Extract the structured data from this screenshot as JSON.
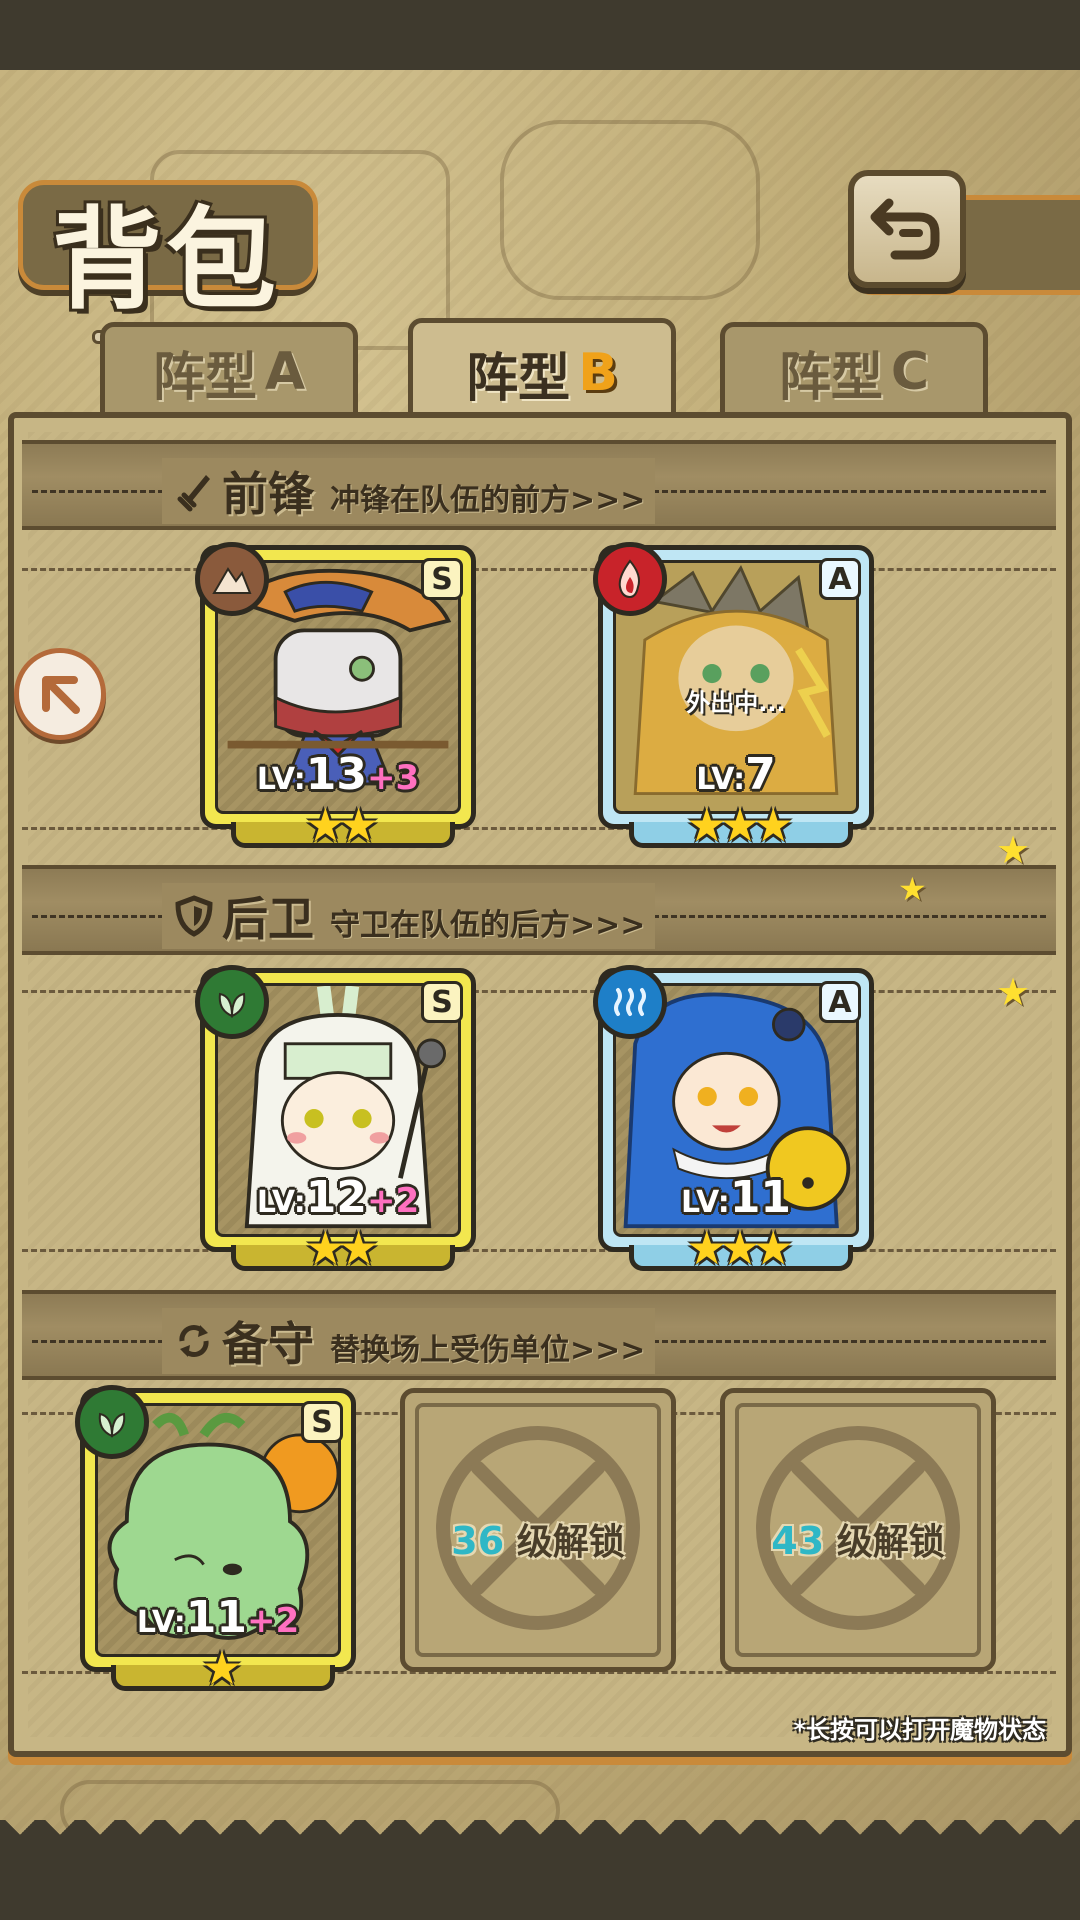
{
  "header": {
    "title": "背包",
    "back_icon": "back-arrow-icon"
  },
  "tabs": [
    {
      "prefix": "阵型",
      "letter": "A",
      "active": false
    },
    {
      "prefix": "阵型",
      "letter": "B",
      "active": true
    },
    {
      "prefix": "阵型",
      "letter": "C",
      "active": false
    }
  ],
  "sections": {
    "vanguard": {
      "icon": "sword-icon",
      "title": "前锋",
      "desc": "冲锋在队伍的前方>>>"
    },
    "rearguard": {
      "icon": "shield-icon",
      "title": "后卫",
      "desc": "守卫在队伍的后方>>>"
    },
    "reserve": {
      "icon": "swap-icon",
      "title": "备守",
      "desc": "替换场上受伤单位>>>"
    }
  },
  "units": {
    "vanguard_1": {
      "rank": "S",
      "element": "earth",
      "lv_prefix": "LV:",
      "level": "13",
      "bonus": "+3",
      "stars": 2
    },
    "vanguard_2": {
      "rank": "A",
      "element": "fire",
      "lv_prefix": "LV:",
      "level": "7",
      "bonus": "",
      "stars": 3,
      "status": "外出中..."
    },
    "rearguard_1": {
      "rank": "S",
      "element": "nature",
      "lv_prefix": "LV:",
      "level": "12",
      "bonus": "+2",
      "stars": 2
    },
    "rearguard_2": {
      "rank": "A",
      "element": "water",
      "lv_prefix": "LV:",
      "level": "11",
      "bonus": "",
      "stars": 3
    },
    "reserve_1": {
      "rank": "S",
      "element": "nature",
      "lv_prefix": "LV:",
      "level": "11",
      "bonus": "+2",
      "stars": 1
    }
  },
  "stars_text": {
    "one": "★",
    "two": "★★",
    "three": "★★★"
  },
  "locked_slots": [
    {
      "level": "36",
      "suffix": "级解锁"
    },
    {
      "level": "43",
      "suffix": "级解锁"
    }
  ],
  "footer_hint": "*长按可以打开魔物状态",
  "colors": {
    "gold_card": "#f2e74f",
    "blue_card": "#bfe6f4",
    "earth": "#8a5a3c",
    "fire": "#c8232a",
    "nature": "#2f7a34",
    "water": "#1e7fc8",
    "active_letter": "#f0a21a",
    "bonus": "#ff70c0",
    "lock_level": "#2fb7c6"
  }
}
